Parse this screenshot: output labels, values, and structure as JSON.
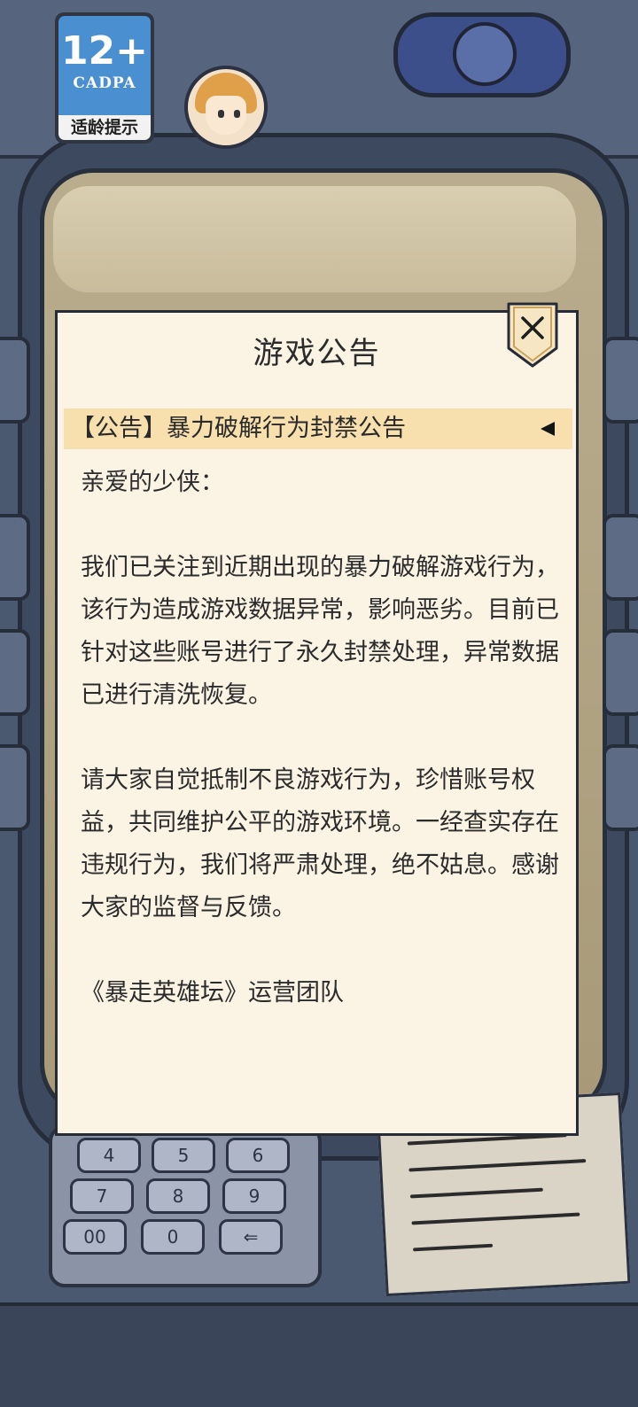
{
  "age_badge": {
    "rating": "12+",
    "org": "CADPA",
    "hint": "适龄提示"
  },
  "dialog": {
    "title": "游戏公告",
    "close_icon": "close-icon",
    "notice": {
      "title": "【公告】暴力破解行为封禁公告",
      "arrow_icon": "triangle-left-icon"
    },
    "greeting": "亲爱的少侠：",
    "paragraph1": "我们已关注到近期出现的暴力破解游戏行为，该行为造成游戏数据异常，影响恶劣。目前已针对这些账号进行了永久封禁处理，异常数据已进行清洗恢复。",
    "paragraph2": "请大家自觉抵制不良游戏行为，珍惜账号权益，共同维护公平的游戏环境。一经查实存在违规行为，我们将严肃处理，绝不姑息。感谢大家的监督与反馈。",
    "signature": "《暴走英雄坛》运营团队"
  },
  "keypad": {
    "keys": [
      "4",
      "5",
      "6",
      "7",
      "8",
      "9",
      "00",
      "0",
      "⇐"
    ]
  },
  "colors": {
    "dialog_bg": "#fbf4e4",
    "notice_bar": "#f8dfae",
    "badge_blue": "#4a8fd0"
  }
}
